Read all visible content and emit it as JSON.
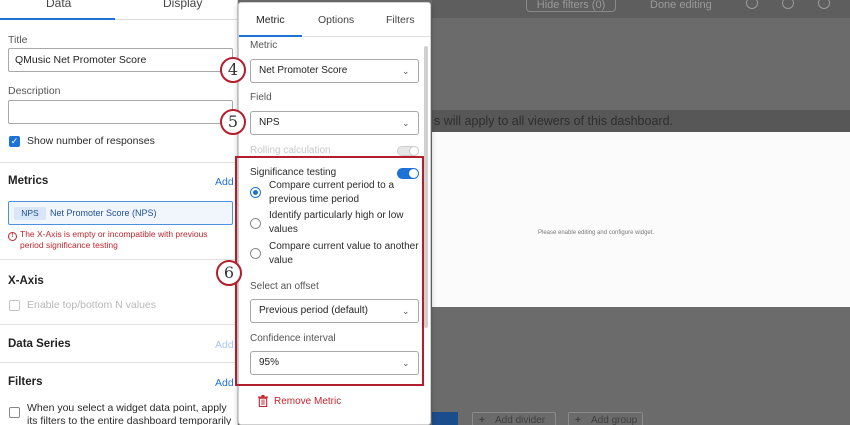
{
  "background": {
    "hide_filters_label": "Hide filters (0)",
    "done_editing_label": "Done editing",
    "banner_text": "s will apply to all viewers of this dashboard.",
    "widget_placeholder": "Please enable editing and configure widget.",
    "add_divider_label": "Add divider",
    "add_group_label": "Add group",
    "top_icons": [
      "gear-icon",
      "user-icon",
      "help-icon"
    ]
  },
  "left_panel": {
    "tabs": {
      "data": "Data",
      "display": "Display"
    },
    "title_label": "Title",
    "title_value": "QMusic Net Promoter Score",
    "description_label": "Description",
    "description_value": "",
    "show_responses_label": "Show number of responses",
    "show_responses_checked": true,
    "metrics_heading": "Metrics",
    "metrics_add": "Add",
    "metric_chip_tag": "NPS",
    "metric_chip_name": "Net Promoter Score (NPS)",
    "xaxis_error": "The X-Axis is empty or incompatible with previous period significance testing",
    "xaxis_heading": "X-Axis",
    "top_bottom_label": "Enable top/bottom N values",
    "data_series_heading": "Data Series",
    "data_series_add": "Add",
    "filters_heading": "Filters",
    "filters_add": "Add",
    "filters_checkbox_label": "When you select a widget data point, apply its filters to the entire dashboard temporarily"
  },
  "popup": {
    "tabs": {
      "metric": "Metric",
      "options": "Options",
      "filters": "Filters"
    },
    "metric_label": "Metric",
    "metric_value": "Net Promoter Score",
    "field_label": "Field",
    "field_value": "NPS",
    "rolling_label": "Rolling calculation",
    "significance_label": "Significance testing",
    "significance_on": true,
    "options": [
      {
        "label": "Compare current period to a previous time period",
        "checked": true
      },
      {
        "label": "Identify particularly high or low values",
        "checked": false
      },
      {
        "label": "Compare current value to another value",
        "checked": false
      }
    ],
    "offset_label": "Select an offset",
    "offset_value": "Previous period (default)",
    "confidence_label": "Confidence interval",
    "confidence_value": "95%",
    "remove_metric": "Remove Metric"
  },
  "callouts": {
    "four": "4",
    "five": "5",
    "six": "6"
  },
  "colors": {
    "accent": "#1d72d6",
    "annotation": "#b31e2d",
    "error": "#c0262d"
  }
}
